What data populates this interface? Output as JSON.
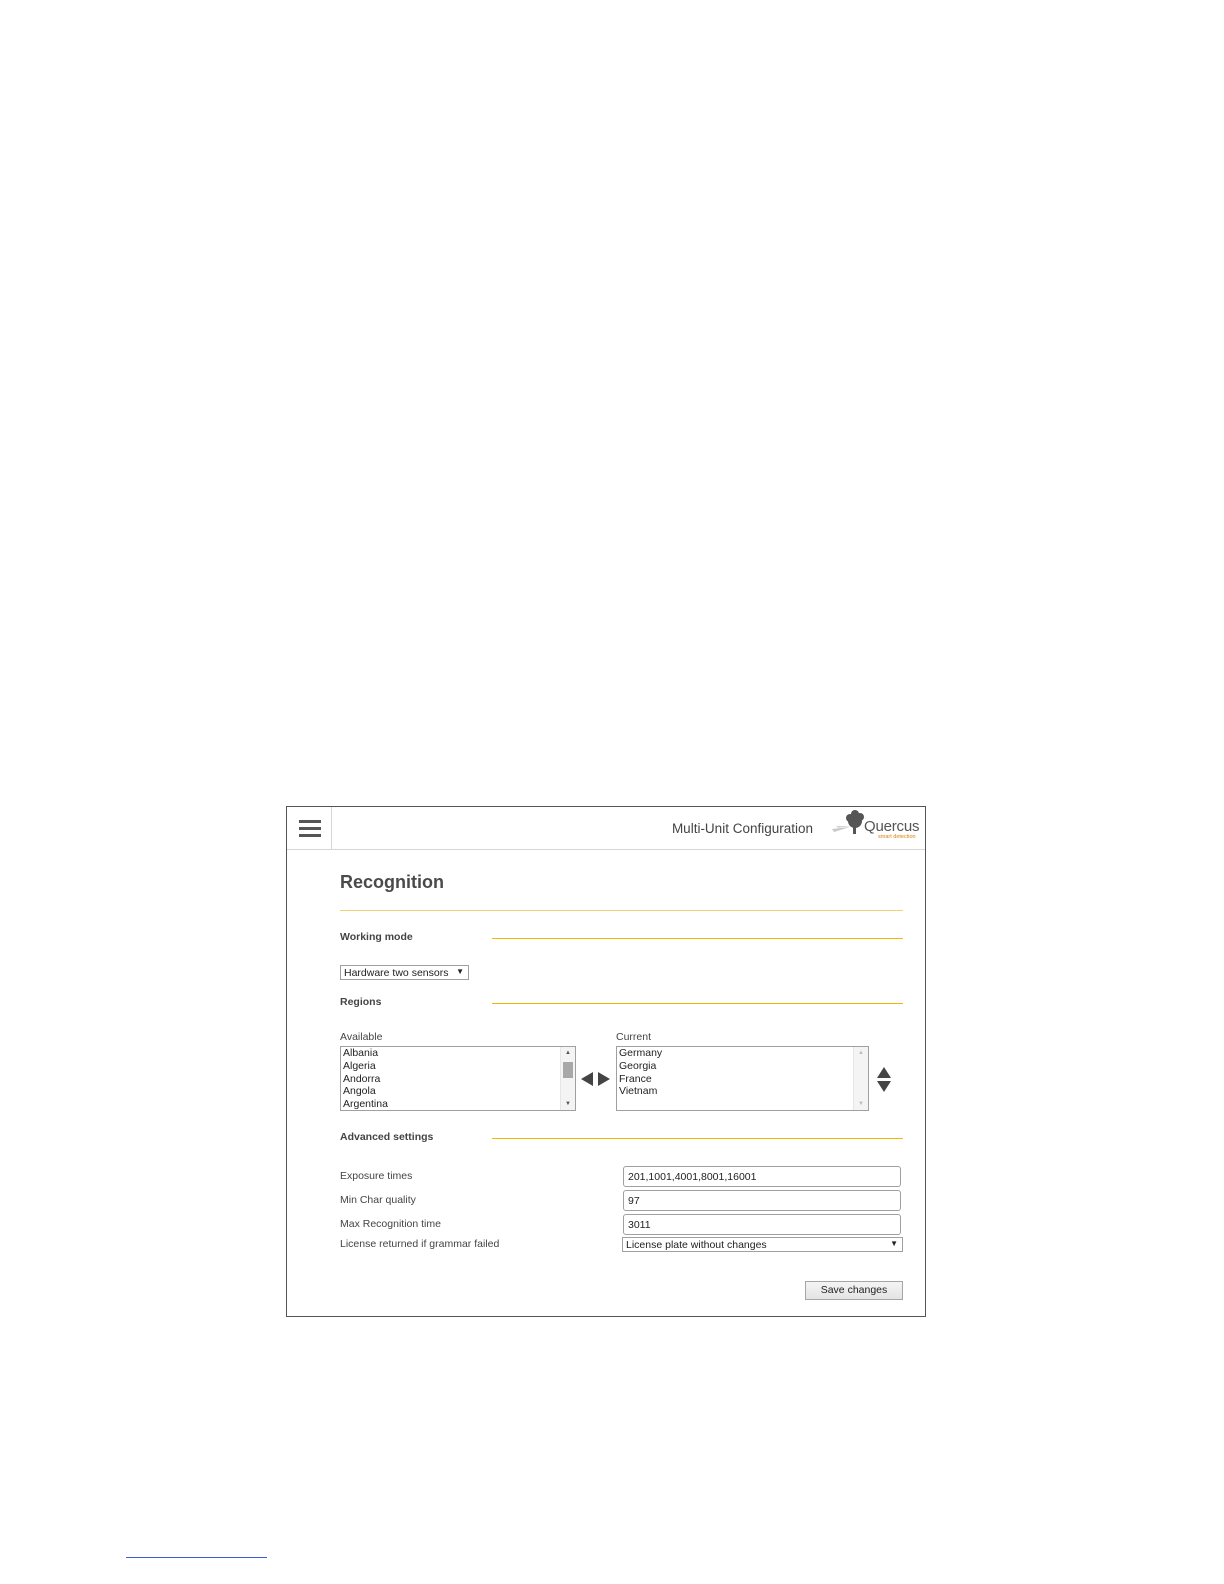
{
  "header": {
    "app_title": "Multi-Unit Configuration",
    "logo_text": "Quercus",
    "logo_tagline": "smart detection",
    "menu_icon": "hamburger-menu-icon"
  },
  "page": {
    "title": "Recognition"
  },
  "working_mode": {
    "label": "Working mode",
    "selected": "Hardware two sensors"
  },
  "regions": {
    "label": "Regions",
    "available_label": "Available",
    "available_items": [
      "Albania",
      "Algeria",
      "Andorra",
      "Angola",
      "Argentina"
    ],
    "current_label": "Current",
    "current_items": [
      "Germany",
      "Georgia",
      "France",
      "Vietnam"
    ],
    "transfer_icons": [
      "arrow-left-icon",
      "arrow-right-icon"
    ],
    "reorder_icons": [
      "arrow-up-icon",
      "arrow-down-icon"
    ]
  },
  "advanced": {
    "label": "Advanced settings",
    "fields": [
      {
        "label": "Exposure times",
        "value": "201,1001,4001,8001,16001"
      },
      {
        "label": "Min Char quality",
        "value": "97"
      },
      {
        "label": "Max Recognition time",
        "value": "3011"
      }
    ],
    "grammar_label": "License returned if grammar failed",
    "grammar_selected": "License plate without changes"
  },
  "actions": {
    "save_label": "Save changes"
  },
  "colors": {
    "accent": "#f2b705",
    "logo_orange": "#e07d10",
    "border": "#555555"
  }
}
